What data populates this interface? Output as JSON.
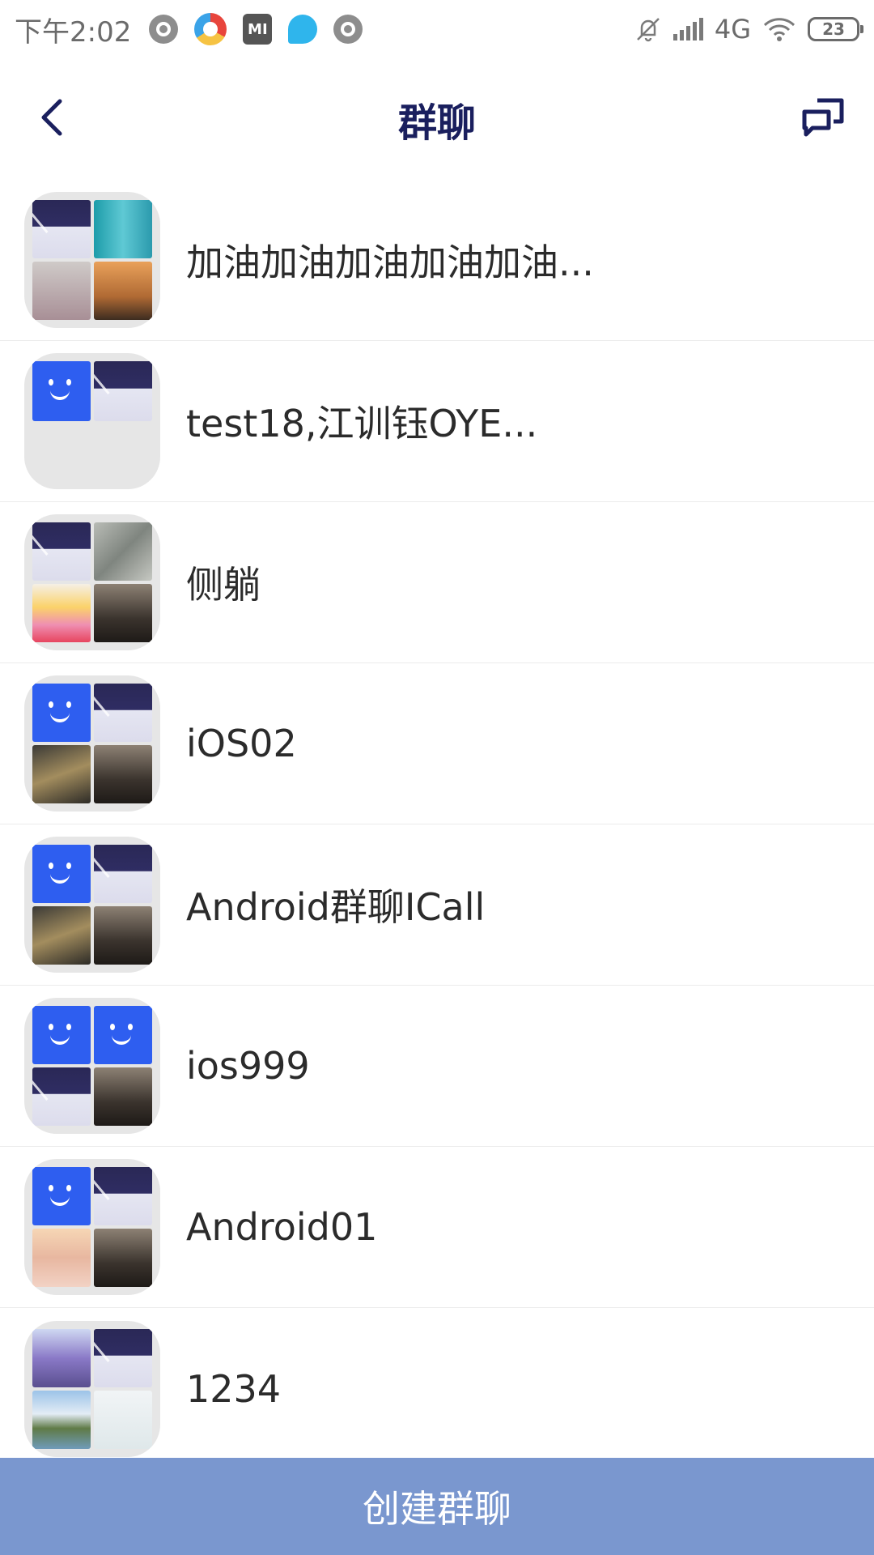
{
  "status_bar": {
    "time": "下午2:02",
    "network": "4G",
    "battery": "23",
    "app_icons": [
      "circle-app-icon",
      "browser-icon",
      "mi-store-icon",
      "bird-app-icon",
      "circle-app-icon"
    ]
  },
  "header": {
    "title": "群聊",
    "back_icon": "chevron-left-icon",
    "action_icon": "new-chat-icon"
  },
  "groups": [
    {
      "name": "加油加油加油加油加油..."
    },
    {
      "name": "test18,江训钰OYE..."
    },
    {
      "name": "侧躺"
    },
    {
      "name": "iOS02"
    },
    {
      "name": "Android群聊ICall"
    },
    {
      "name": "ios999"
    },
    {
      "name": "Android01"
    },
    {
      "name": "1234"
    }
  ],
  "footer": {
    "create_label": "创建群聊"
  },
  "colors": {
    "title": "#1a1f5e",
    "create_button_bg": "#7a97cf",
    "divider": "#ececec"
  }
}
